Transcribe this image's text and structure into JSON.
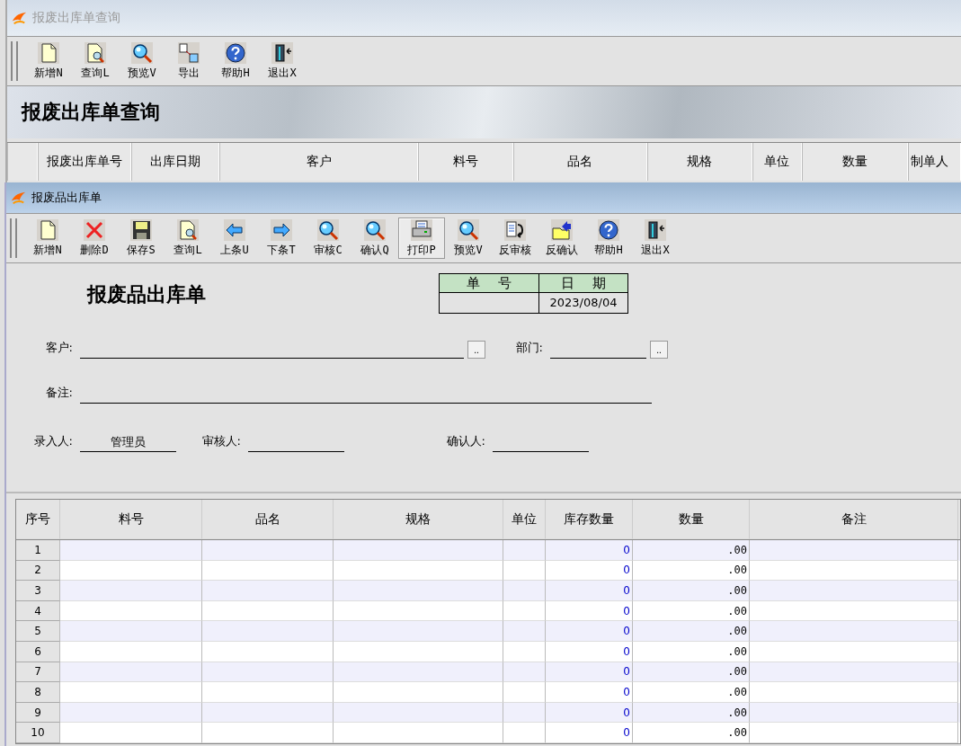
{
  "back_window": {
    "title": "报废出库单查询",
    "toolbar": [
      {
        "kind": "new",
        "label": "新增N"
      },
      {
        "kind": "query",
        "label": "查询L"
      },
      {
        "kind": "magnifier",
        "label": "预览V"
      },
      {
        "kind": "export",
        "label": "导出"
      },
      {
        "kind": "help",
        "label": "帮助H"
      },
      {
        "kind": "exit",
        "label": "退出X"
      }
    ],
    "banner_title": "报废出库单查询",
    "columns": [
      "报废出库单号",
      "出库日期",
      "客户",
      "料号",
      "品名",
      "规格",
      "单位",
      "数量",
      "制单人"
    ]
  },
  "window": {
    "title": "报废品出库单",
    "toolbar": [
      {
        "kind": "new",
        "label": "新增N",
        "pressed": false
      },
      {
        "kind": "delete",
        "label": "删除D",
        "pressed": false
      },
      {
        "kind": "save",
        "label": "保存S",
        "pressed": false
      },
      {
        "kind": "query",
        "label": "查询L",
        "pressed": false
      },
      {
        "kind": "prev",
        "label": "上条U",
        "pressed": false
      },
      {
        "kind": "next",
        "label": "下条T",
        "pressed": false
      },
      {
        "kind": "magnifier",
        "label": "审核C",
        "pressed": false
      },
      {
        "kind": "magnifier",
        "label": "确认Q",
        "pressed": false
      },
      {
        "kind": "print",
        "label": "打印P",
        "pressed": true
      },
      {
        "kind": "magnifier",
        "label": "预览V",
        "pressed": false
      },
      {
        "kind": "unaudit",
        "label": "反审核",
        "pressed": false
      },
      {
        "kind": "unconfirm",
        "label": "反确认",
        "pressed": false
      },
      {
        "kind": "help",
        "label": "帮助H",
        "pressed": false
      },
      {
        "kind": "exit",
        "label": "退出X",
        "pressed": false
      }
    ],
    "form": {
      "title": "报废品出库单",
      "number_box": {
        "number_label": "单 号",
        "date_label": "日 期",
        "date": "2023/08/04"
      },
      "customer": {
        "label": "客户:",
        "browse": ".."
      },
      "department": {
        "label": "部门:",
        "browse": ".."
      },
      "remark": {
        "label": "备注:"
      },
      "entered_by": {
        "label": "录入人:",
        "value": "管理员"
      },
      "reviewer": {
        "label": "审核人:"
      },
      "confirmer": {
        "label": "确认人:"
      }
    },
    "grid": {
      "columns": [
        "序号",
        "料号",
        "品名",
        "规格",
        "单位",
        "库存数量",
        "数量",
        "备注"
      ],
      "rows": [
        {
          "no": "1",
          "stock": "0",
          "qty": ".00"
        },
        {
          "no": "2",
          "stock": "0",
          "qty": ".00"
        },
        {
          "no": "3",
          "stock": "0",
          "qty": ".00"
        },
        {
          "no": "4",
          "stock": "0",
          "qty": ".00"
        },
        {
          "no": "5",
          "stock": "0",
          "qty": ".00"
        },
        {
          "no": "6",
          "stock": "0",
          "qty": ".00"
        },
        {
          "no": "7",
          "stock": "0",
          "qty": ".00"
        },
        {
          "no": "8",
          "stock": "0",
          "qty": ".00"
        },
        {
          "no": "9",
          "stock": "0",
          "qty": ".00"
        },
        {
          "no": "10",
          "stock": "0",
          "qty": ".00"
        }
      ]
    }
  }
}
